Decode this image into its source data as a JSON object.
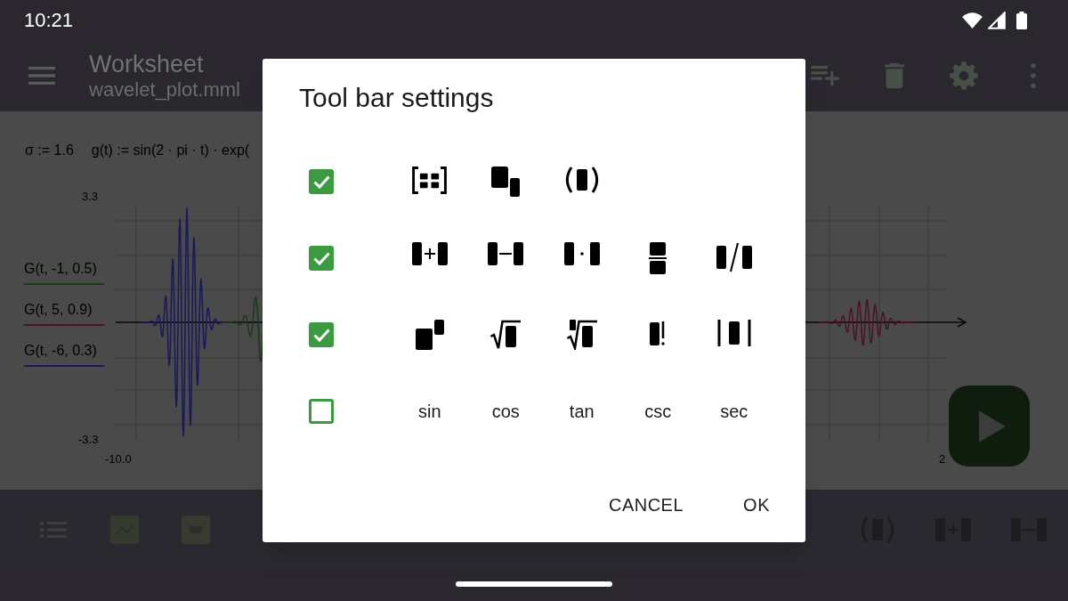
{
  "status_bar": {
    "time": "10:21"
  },
  "app_bar": {
    "title": "Worksheet",
    "subtitle": "wavelet_plot.mml"
  },
  "worksheet": {
    "formulas": [
      "σ := 1.6",
      "g(t) := sin(2 · pi · t) · exp("
    ],
    "plot": {
      "y_max": "3.3",
      "y_min": "-3.3",
      "x_min": "-10.0",
      "x_max": "2",
      "legend": [
        {
          "label": "G(t, -1, 0.5)",
          "color": "#1d3a1d"
        },
        {
          "label": "G(t, 5, 0.9)",
          "color": "#4d1124"
        },
        {
          "label": "G(t, -6, 0.3)",
          "color": "#18185e"
        }
      ]
    }
  },
  "dialog": {
    "title": "Tool bar settings",
    "rows": [
      {
        "checked": true,
        "kind": "icons"
      },
      {
        "checked": true,
        "kind": "icons"
      },
      {
        "checked": true,
        "kind": "icons"
      },
      {
        "checked": false,
        "kind": "labels",
        "labels": [
          "sin",
          "cos",
          "tan",
          "csc",
          "sec"
        ]
      }
    ],
    "buttons": [
      "CANCEL",
      "OK"
    ]
  }
}
